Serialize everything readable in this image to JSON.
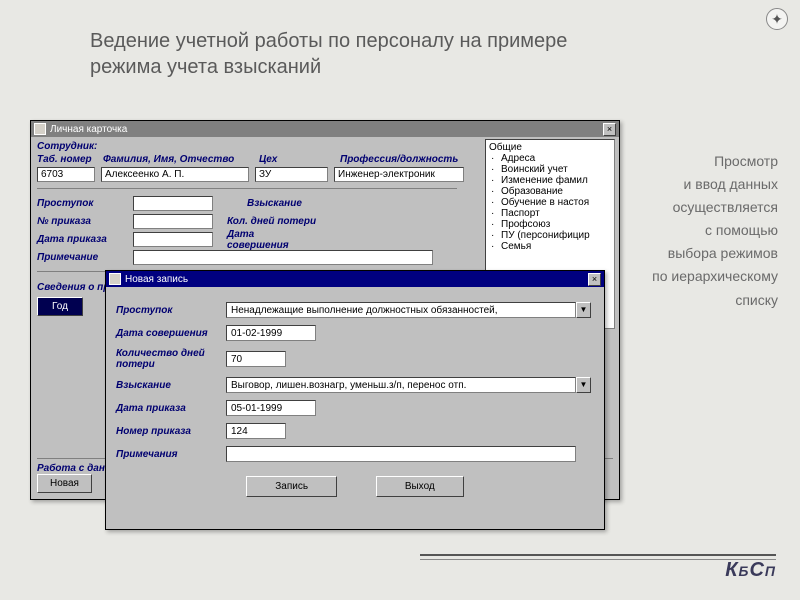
{
  "slide": {
    "title": "Ведение учетной работы по персоналу на примере режима учета взысканий",
    "side_text": [
      "Просмотр",
      "и ввод данных",
      "осуществляется",
      "с помощью",
      "выбора режимов",
      "по иерархическому",
      "списку"
    ],
    "brand": {
      "k": "К",
      "b": "Б",
      "s": "С",
      "p": "П"
    }
  },
  "back_window": {
    "title": "Личная карточка",
    "employee_header": "Сотрудник:",
    "col_tab": "Таб. номер",
    "col_fio": "Фамилия, Имя, Отчество",
    "col_ceh": "Цех",
    "col_prof": "Профессия/должность",
    "val_tab": "6703",
    "val_fio": "Алексеенко А. П.",
    "val_ceh": "ЗУ",
    "val_prof": "Инженер-электроник",
    "lbl_prostupok": "Проступок",
    "lbl_vzisk": "Взыскание",
    "lbl_noprikaz": "№ приказа",
    "lbl_koldney": "Кол. дней потери",
    "lbl_dataprikaz": "Дата приказа",
    "lbl_datasov": "Дата совершения",
    "lbl_prim": "Примечание",
    "info_header": "Сведения о прос",
    "year_btn": "Год",
    "bottom_label": "Работа с данны",
    "bottom_btn": "Новая"
  },
  "tree": {
    "root": "Общие",
    "items": [
      "Адреса",
      "Воинский учет",
      "Изменение фамил",
      "Образование",
      "Обучение в настоя",
      "Паспорт",
      "Профсоюз",
      "ПУ (персонифицир",
      "Семья"
    ]
  },
  "dialog": {
    "title": "Новая запись",
    "lbl_prostupok": "Проступок",
    "val_prostupok": "Ненадлежащие выполнение должностных обязанностей,",
    "lbl_datasov": "Дата совершения",
    "val_datasov": "01-02-1999",
    "lbl_koldney": "Количество дней потери",
    "val_koldney": "70",
    "lbl_vzisk": "Взыскание",
    "val_vzisk": "Выговор, лишен.вознагр, уменьш.з/п, перенос отп.",
    "lbl_dataprikaz": "Дата приказа",
    "val_dataprikaz": "05-01-1999",
    "lbl_noprikaz": "Номер приказа",
    "val_noprikaz": "124",
    "lbl_prim": "Примечания",
    "btn_save": "Запись",
    "btn_exit": "Выход"
  }
}
